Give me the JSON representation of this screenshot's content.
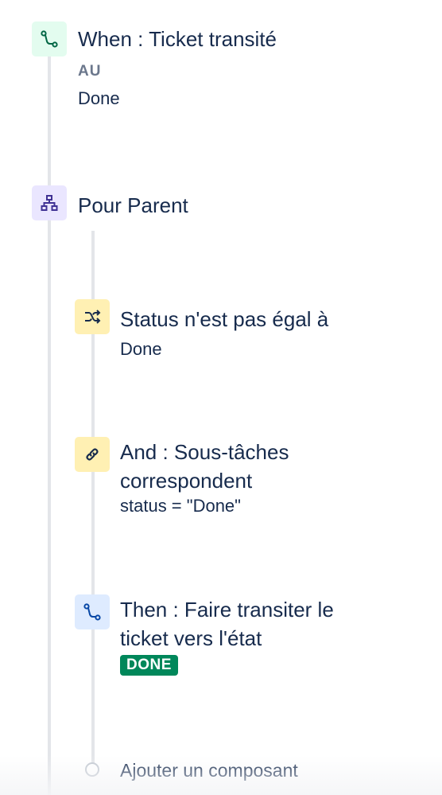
{
  "trigger": {
    "title": "When : Ticket transité",
    "label": "AU",
    "value": "Done",
    "icon": "transition-icon",
    "icon_color": "#006644"
  },
  "branch": {
    "title": "Pour Parent",
    "icon": "hierarchy-icon",
    "icon_color": "#403294"
  },
  "condition": {
    "title": "Status n'est pas égal à",
    "value": "Done",
    "icon": "shuffle-icon",
    "icon_color": "#172b4d"
  },
  "related_condition": {
    "title_line1": "And : Sous-tâches",
    "title_line2": "correspondent",
    "value": "status = \"Done\"",
    "icon": "link-icon",
    "icon_color": "#172b4d"
  },
  "action": {
    "title_line1": "Then : Faire transiter le",
    "title_line2": "ticket vers l'état",
    "status_lozenge": "DONE",
    "lozenge_color": "#00875a",
    "icon": "transition-icon",
    "icon_color": "#0747a6"
  },
  "add_component": {
    "label": "Ajouter un composant"
  }
}
